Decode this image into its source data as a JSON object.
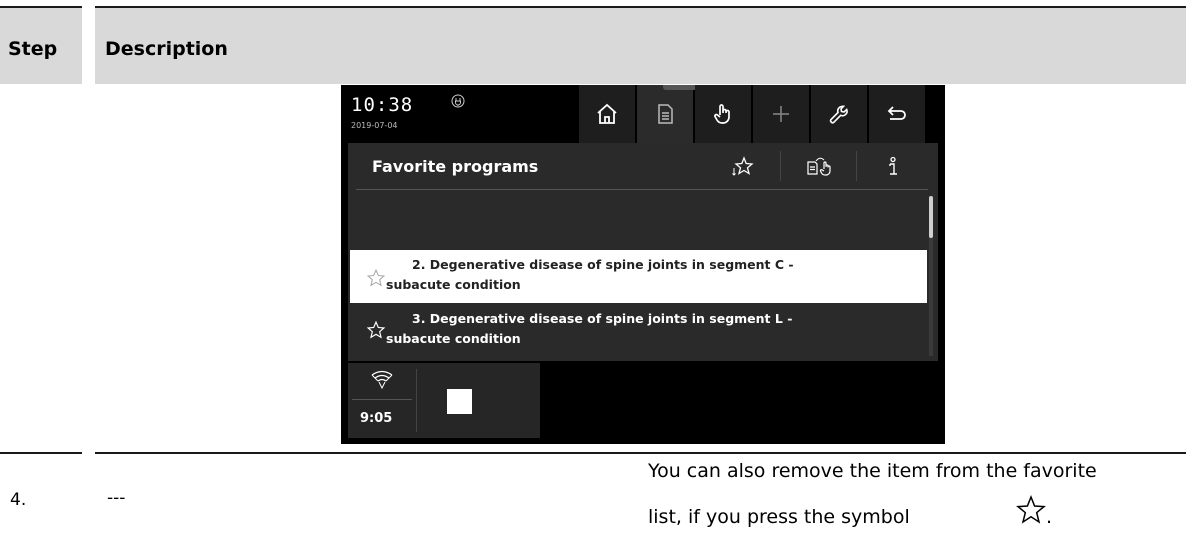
{
  "table": {
    "header_step": "Step",
    "header_description": "Description"
  },
  "device": {
    "clock": "10:38",
    "date": "2019-07-04",
    "topbar_icons": [
      "home-icon",
      "document-icon",
      "hand-icon",
      "plus-icon",
      "wrench-icon",
      "back-icon"
    ],
    "panel": {
      "title": "Favorite programs",
      "buttons": [
        "star-sort-icon",
        "document-hand-icon",
        "info-icon"
      ],
      "items": [
        {
          "line1": "2. Degenerative disease of spine joints in segment C -",
          "line2": "subacute condition",
          "selected": true
        },
        {
          "line1": "3. Degenerative disease of spine joints in segment L -",
          "line2": "subacute condition",
          "selected": false
        }
      ]
    },
    "therapy": {
      "time": "9:05"
    }
  },
  "step4": {
    "number": "4.",
    "action": "---",
    "note_line1": "You can also remove the item from the favorite",
    "note_line2": "list, if you press the symbol",
    "note_end": "."
  }
}
